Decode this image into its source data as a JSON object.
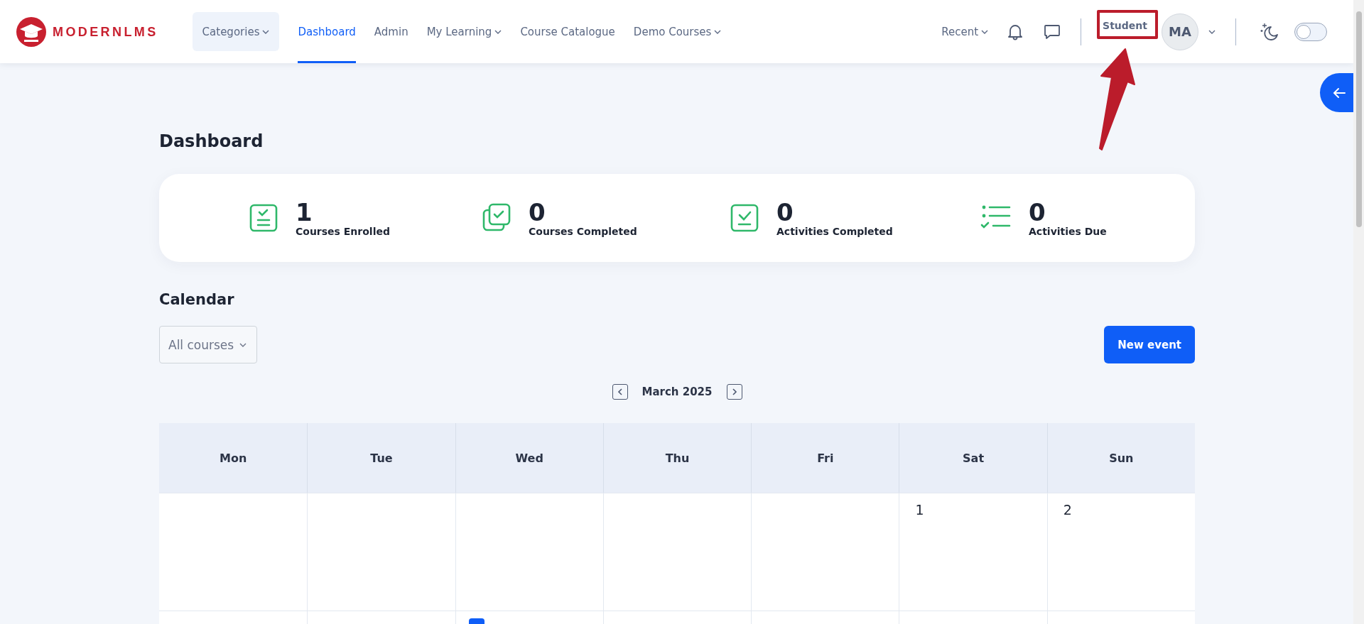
{
  "logo": {
    "text": "MODERNLMS"
  },
  "nav": [
    {
      "label": "Categories",
      "kind": "menu-button",
      "selected": false
    },
    {
      "label": "Dashboard",
      "kind": "link",
      "selected": true
    },
    {
      "label": "Admin",
      "kind": "link",
      "selected": false
    },
    {
      "label": "My Learning",
      "kind": "menu",
      "selected": false
    },
    {
      "label": "Course Catalogue",
      "kind": "link",
      "selected": false
    },
    {
      "label": "Demo Courses",
      "kind": "menu",
      "selected": false
    }
  ],
  "recent": {
    "label": "Recent"
  },
  "role": {
    "label": "Student"
  },
  "avatar": {
    "initials": "MA"
  },
  "dark_mode": {
    "on": false
  },
  "page_title": "Dashboard",
  "stats": [
    {
      "kind": "enrolled",
      "value": "1",
      "label": "Courses Enrolled"
    },
    {
      "kind": "courses-completed",
      "value": "0",
      "label": "Courses Completed"
    },
    {
      "kind": "activities-completed",
      "value": "0",
      "label": "Activities Completed"
    },
    {
      "kind": "activities-due",
      "value": "0",
      "label": "Activities Due"
    }
  ],
  "calendar": {
    "title": "Calendar",
    "filter": {
      "value": "All courses"
    },
    "new_event": "New event",
    "month": "March 2025",
    "weekdays": [
      "Mon",
      "Tue",
      "Wed",
      "Thu",
      "Fri",
      "Sat",
      "Sun"
    ],
    "weeks": [
      [
        {
          "kind": "empty"
        },
        {
          "kind": "empty"
        },
        {
          "kind": "empty"
        },
        {
          "kind": "empty"
        },
        {
          "kind": "empty"
        },
        {
          "kind": "day",
          "day": "1",
          "today": false
        },
        {
          "kind": "day",
          "day": "2",
          "today": false
        }
      ],
      [
        {
          "kind": "day",
          "today": false
        },
        {
          "kind": "day",
          "today": false
        },
        {
          "kind": "day",
          "today": true
        },
        {
          "kind": "day",
          "today": false
        },
        {
          "kind": "day",
          "today": false
        },
        {
          "kind": "day",
          "today": false
        },
        {
          "kind": "day",
          "today": false
        }
      ]
    ]
  }
}
